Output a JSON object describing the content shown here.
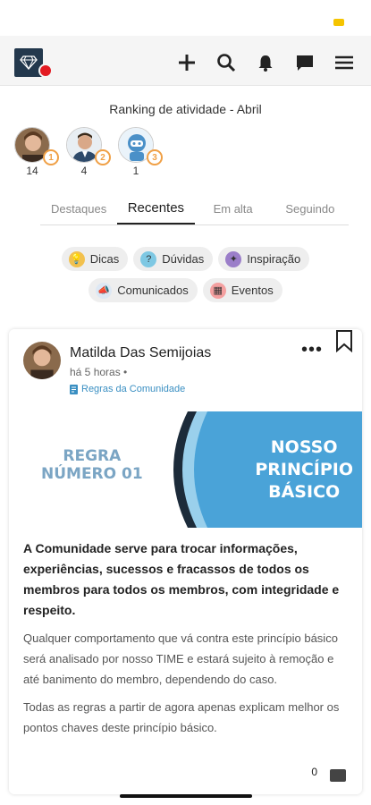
{
  "ranking": {
    "title": "Ranking de atividade - Abril",
    "users": [
      {
        "count": "14",
        "medal": "1"
      },
      {
        "count": "4",
        "medal": "2"
      },
      {
        "count": "1",
        "medal": "3"
      }
    ]
  },
  "tabs": [
    "Destaques",
    "Recentes",
    "Em alta",
    "Seguindo"
  ],
  "chips": [
    "Dicas",
    "Dúvidas",
    "Inspiração",
    "Comunicados",
    "Eventos"
  ],
  "post": {
    "author": "Matilda Das Semijoias",
    "time": "há 5 horas •",
    "category": "Regras da Comunidade",
    "banner_left_line1": "REGRA",
    "banner_left_line2": "NÚMERO 01",
    "banner_right_line1": "NOSSO",
    "banner_right_line2": "PRINCÍPIO",
    "banner_right_line3": "BÁSICO",
    "lead": "A Comunidade serve para trocar informações, experiências, sucessos e fracassos de todos os membros para todos os membros, com integridade e respeito.",
    "para1": "Qualquer comportamento que vá contra este princípio básico será analisado por nosso TIME e estará sujeito à remoção e até banimento do membro, dependendo do caso.",
    "para2": "Todas as regras a partir de agora apenas explicam melhor os pontos chaves deste princípio básico.",
    "comment_count": "0"
  },
  "colors": {
    "accent_blue": "#3a8fc2",
    "banner_blue": "#4aa3d8",
    "logo_bg": "#23384d",
    "badge_red": "#e31b23"
  }
}
